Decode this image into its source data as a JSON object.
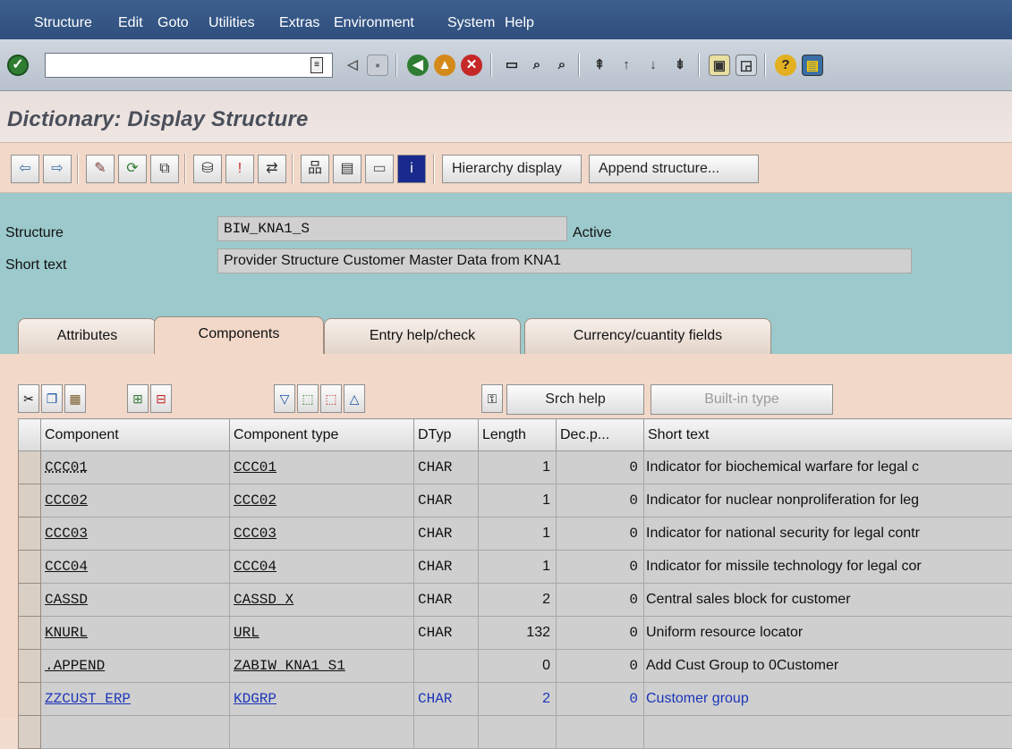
{
  "menu": [
    "Structure",
    "Edit",
    "Goto",
    "Utilities",
    "Extras",
    "Environment",
    "System",
    "Help"
  ],
  "title": "Dictionary: Display Structure",
  "app_toolbar": {
    "hierarchy_label": "Hierarchy display",
    "append_label": "Append structure..."
  },
  "header": {
    "structure_label": "Structure",
    "structure_value": "BIW_KNA1_S",
    "status": "Active",
    "short_text_label": "Short text",
    "short_text_value": "Provider Structure  Customer Master Data from KNA1"
  },
  "tabs": [
    "Attributes",
    "Components",
    "Entry help/check",
    "Currency/cuantity fields"
  ],
  "grid_toolbar": {
    "srch_help": "Srch help",
    "builtin": "Built-in type"
  },
  "columns": [
    "Component",
    "Component type",
    "DTyp",
    "Length",
    "Dec.p...",
    "Short text"
  ],
  "rows": [
    {
      "component": "CCC01",
      "type": "CCC01",
      "dtyp": "CHAR",
      "length": "1",
      "dec": "0",
      "text": "Indicator for biochemical warfare for legal c"
    },
    {
      "component": "CCC02",
      "type": "CCC02",
      "dtyp": "CHAR",
      "length": "1",
      "dec": "0",
      "text": "Indicator for nuclear nonproliferation for leg"
    },
    {
      "component": "CCC03",
      "type": "CCC03",
      "dtyp": "CHAR",
      "length": "1",
      "dec": "0",
      "text": "Indicator for national security for legal contr"
    },
    {
      "component": "CCC04",
      "type": "CCC04",
      "dtyp": "CHAR",
      "length": "1",
      "dec": "0",
      "text": "Indicator for missile technology for legal cor"
    },
    {
      "component": "CASSD",
      "type": "CASSD_X",
      "dtyp": "CHAR",
      "length": "2",
      "dec": "0",
      "text": "Central sales block for customer"
    },
    {
      "component": "KNURL",
      "type": "URL",
      "dtyp": "CHAR",
      "length": "132",
      "dec": "0",
      "text": "Uniform resource locator"
    },
    {
      "component": ".APPEND",
      "type": "ZABIW_KNA1_S1",
      "dtyp": "",
      "length": "0",
      "dec": "0",
      "text": "Add Cust Group to 0Customer"
    },
    {
      "component": "ZZCUST_ERP",
      "type": "KDGRP",
      "dtyp": "CHAR",
      "length": "2",
      "dec": "0",
      "text": "Customer group"
    }
  ],
  "colors": {
    "menubar": "#2f4f7d",
    "header_bg": "#9cc9cc",
    "content_bg": "#f2d8c8",
    "append_text": "#1d35b8"
  }
}
